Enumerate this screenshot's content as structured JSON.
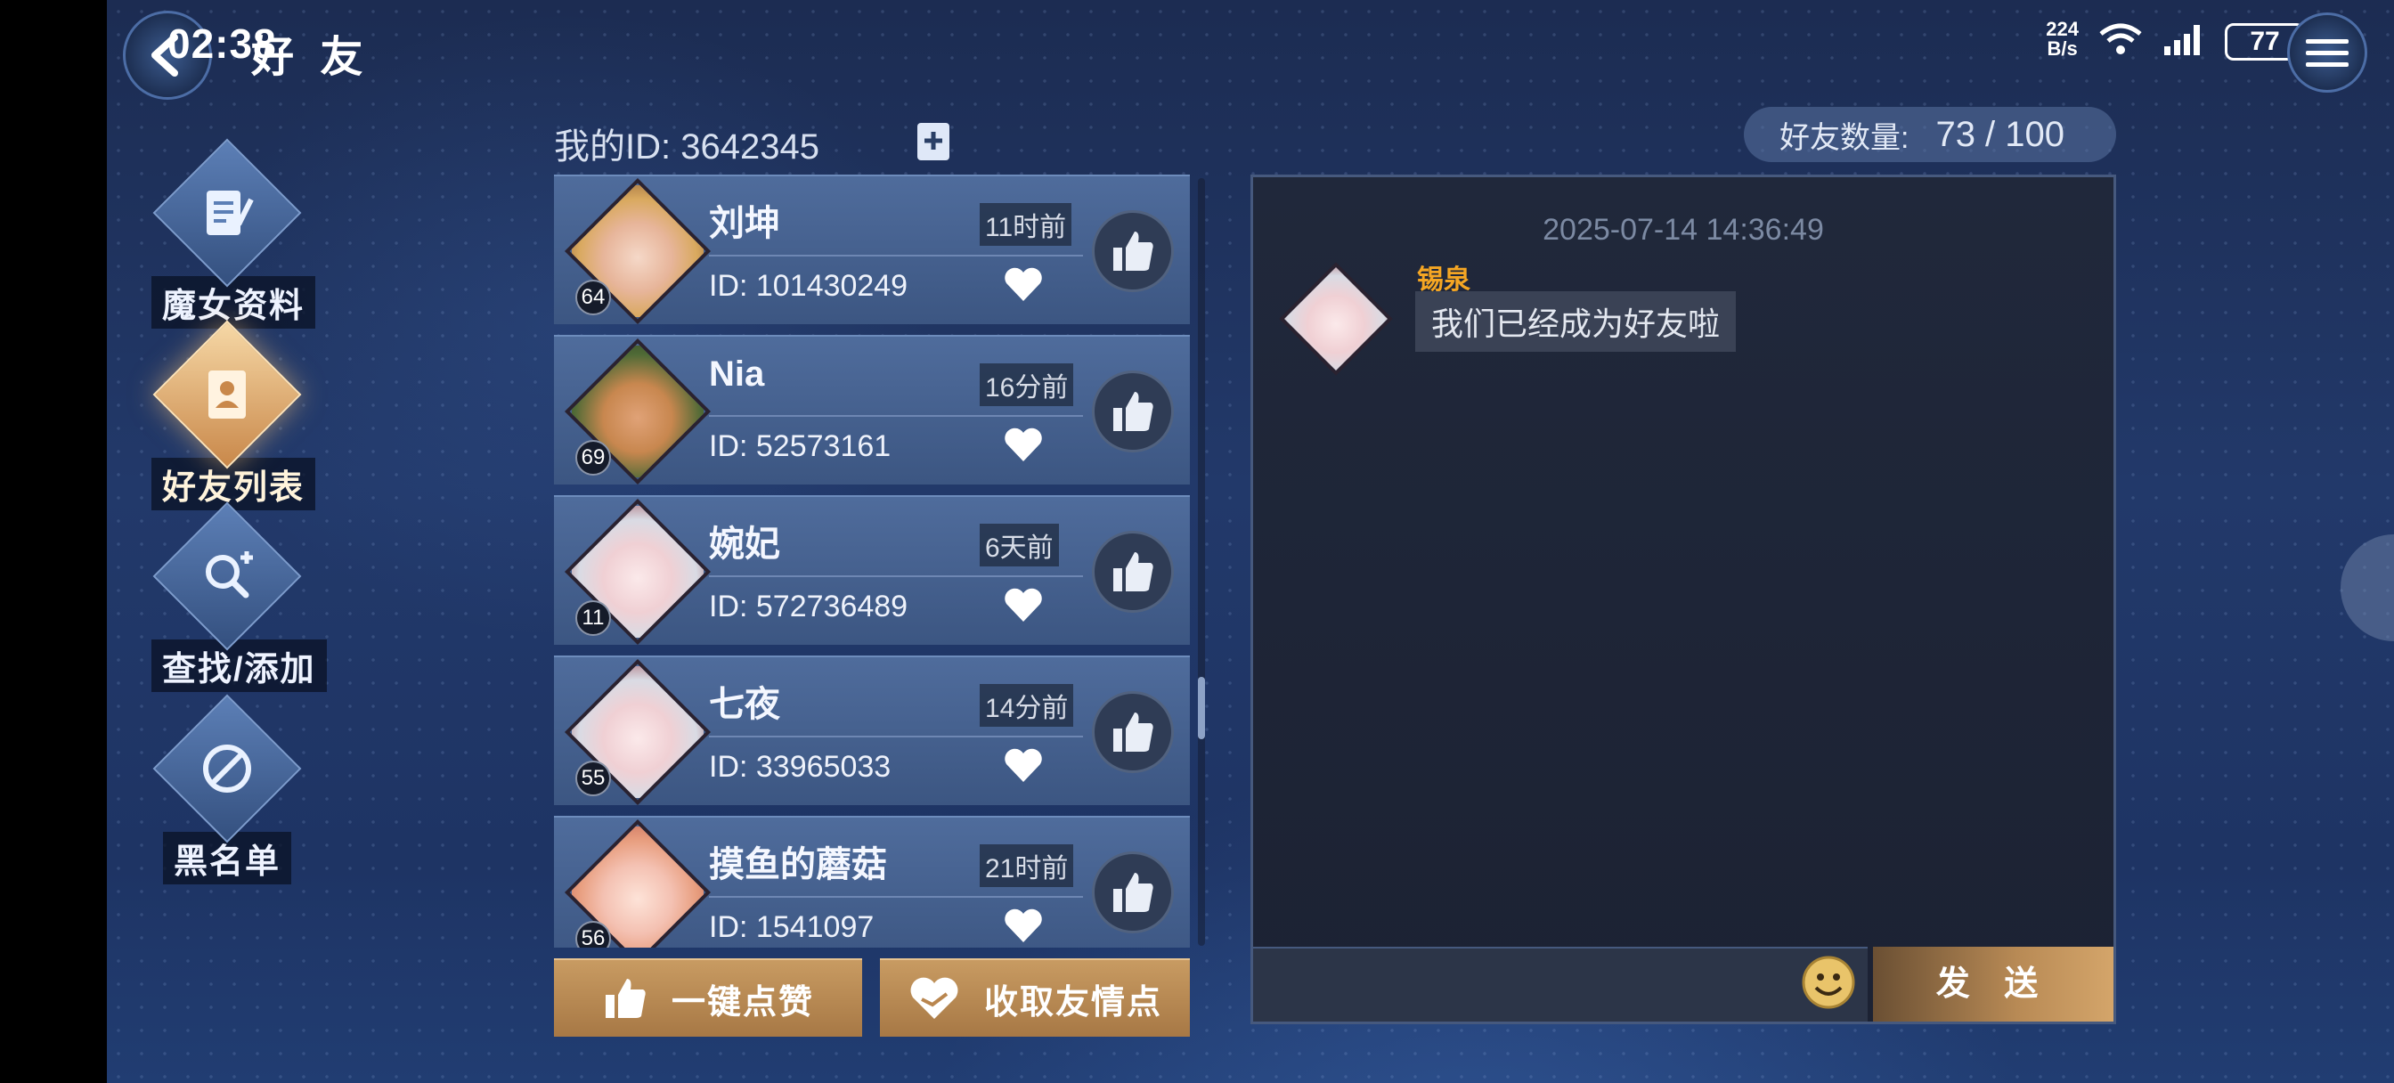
{
  "status_bar": {
    "time": "02:38",
    "net_speed_value": "224",
    "net_speed_unit": "B/s",
    "battery": "77"
  },
  "header": {
    "title": "好 友"
  },
  "sidebar": {
    "items": [
      {
        "label": "魔女资料",
        "icon": "notebook-icon",
        "active": false
      },
      {
        "label": "好友列表",
        "icon": "contact-book-icon",
        "active": true
      },
      {
        "label": "查找/添加",
        "icon": "search-add-icon",
        "active": false
      },
      {
        "label": "黑名单",
        "icon": "block-icon",
        "active": false
      }
    ]
  },
  "profile": {
    "my_id": "我的ID: 3642345"
  },
  "friend_count": {
    "label": "好友数量:",
    "value": "73 / 100"
  },
  "friends": [
    {
      "name": "刘坤",
      "id": "ID: 101430249",
      "time": "11时前",
      "level": "64"
    },
    {
      "name": "Nia",
      "id": "ID: 52573161",
      "time": "16分前",
      "level": "69"
    },
    {
      "name": "婉妃",
      "id": "ID: 572736489",
      "time": "6天前",
      "level": "11"
    },
    {
      "name": "七夜",
      "id": "ID: 33965033",
      "time": "14分前",
      "level": "55"
    },
    {
      "name": "摸鱼的蘑菇",
      "id": "ID: 1541097",
      "time": "21时前",
      "level": "56"
    }
  ],
  "actions": {
    "like_all": "一键点赞",
    "collect_points": "收取友情点"
  },
  "chat": {
    "timestamp": "2025-07-14 14:36:49",
    "sender": "锡泉",
    "message": "我们已经成为好友啦",
    "send_label": "发 送"
  },
  "colors": {
    "accent_gold": "#c89b62",
    "sender_name": "#f5a623"
  }
}
